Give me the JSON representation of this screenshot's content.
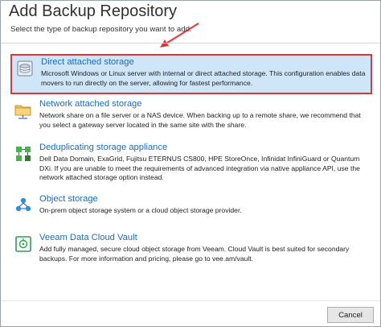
{
  "header": {
    "title": "Add Backup Repository",
    "subtitle": "Select the type of backup repository you want to add."
  },
  "colors": {
    "accent": "#1a6cb8",
    "selected_bg": "#cfe6f8",
    "highlight_border": "#e0363b"
  },
  "options": [
    {
      "icon": "disk-storage-icon",
      "title": "Direct attached storage",
      "description": "Microsoft Windows or Linux server with internal or direct attached storage. This configuration enables data movers to run directly on the server, allowing for fastest performance.",
      "selected": true
    },
    {
      "icon": "network-folder-icon",
      "title": "Network attached storage",
      "description": "Network share on a file server or a NAS device. When backing up to a remote share, we recommend that you select a gateway server located in the same site with the share.",
      "selected": false
    },
    {
      "icon": "dedup-appliance-icon",
      "title": "Deduplicating storage appliance",
      "description": "Dell Data Domain, ExaGrid, Fujitsu ETERNUS CS800, HPE StoreOnce, Infinidat InfiniGuard or Quantum DXi. If you are unable to meet the requirements of advanced integration via native appliance API, use the network attached storage option instead.",
      "selected": false
    },
    {
      "icon": "object-storage-icon",
      "title": "Object storage",
      "description": "On-prem object storage system or a cloud object storage provider.",
      "selected": false
    },
    {
      "icon": "cloud-vault-icon",
      "title": "Veeam Data Cloud Vault",
      "description": "Add fully managed, secure cloud object storage from Veeam. Cloud Vault is best suited for secondary backups. For more information and pricing, please go to vee.am/vault.",
      "selected": false
    }
  ],
  "footer": {
    "cancel_label": "Cancel"
  }
}
